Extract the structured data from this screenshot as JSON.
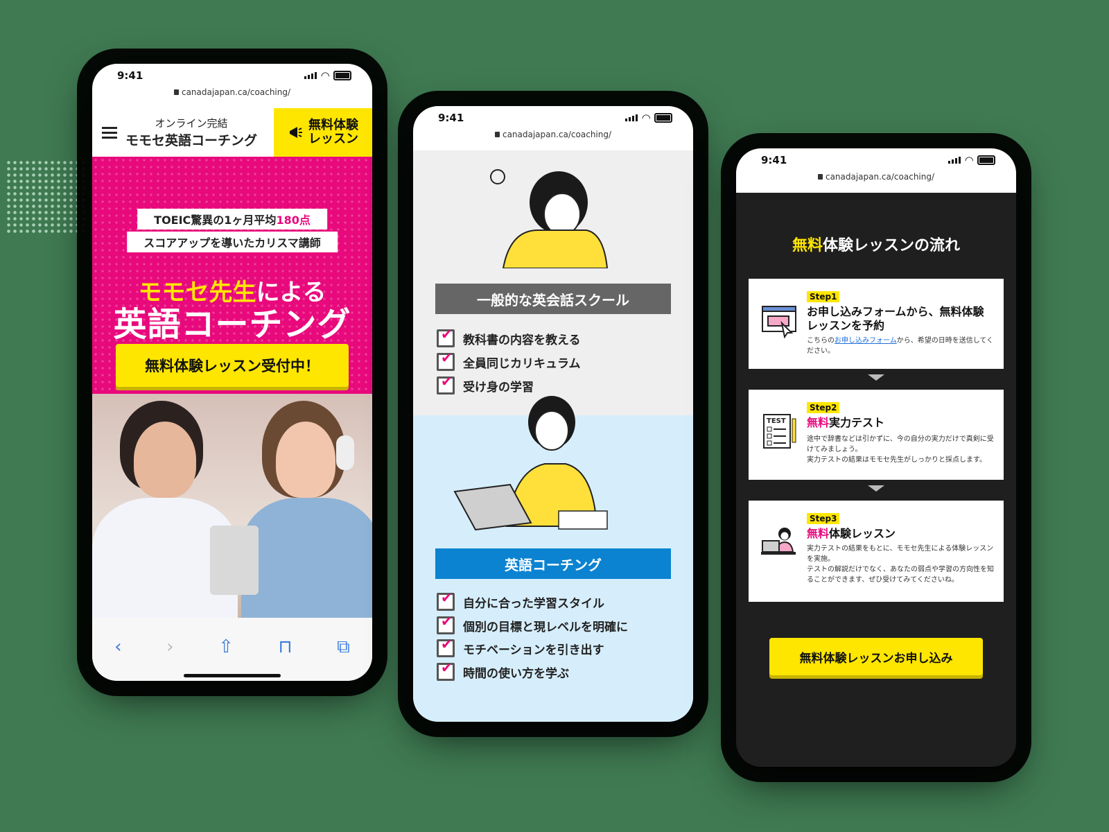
{
  "status": {
    "time": "9:41"
  },
  "url": "canadajapan.ca/coaching/",
  "phone1": {
    "brand_small": "オンライン完結",
    "brand_large": "モモセ英語コーチング",
    "header_cta": [
      "無料体験",
      "レッスン"
    ],
    "pill1_prefix": "TOEIC驚異の1ヶ月平均",
    "pill1_highlight": "180点",
    "pill2": "スコアアップを導いたカリスマ講師",
    "headline_highlight": "モモセ先生",
    "headline_rest": "による",
    "headline_main": "英語コーチング",
    "hero_button": "無料体験レッスン受付中！",
    "toolbar": [
      "back-icon",
      "forward-icon",
      "share-icon",
      "bookmarks-icon",
      "tabs-icon"
    ]
  },
  "phone2": {
    "label_general": "一般的な英会話スクール",
    "general_items": [
      "教科書の内容を教える",
      "全員同じカリキュラム",
      "受け身の学習"
    ],
    "label_coaching": "英語コーチング",
    "coaching_items": [
      "自分に合った学習スタイル",
      "個別の目標と現レベルを明確に",
      "モチベーションを引き出す",
      "時間の使い方を学ぶ"
    ]
  },
  "phone3": {
    "title_highlight": "無料",
    "title_rest": "体験レッスンの流れ",
    "steps": [
      {
        "tag": "Step1",
        "title": "お申し込みフォームから、無料体験レッスンを予約",
        "desc_pre": "こちらの",
        "desc_link": "お申し込みフォーム",
        "desc_post": "から、希望の日時を送信してください。"
      },
      {
        "tag": "Step2",
        "title_highlight": "無料",
        "title_rest": "実力テスト",
        "desc": "途中で辞書などは引かずに、今の自分の実力だけで真剣に受けてみましょう。",
        "desc2": "実力テストの結果はモモセ先生がしっかりと採点します。"
      },
      {
        "tag": "Step3",
        "title_highlight": "無料",
        "title_rest": "体験レッスン",
        "desc": "実力テストの結果をもとに、モモセ先生による体験レッスンを実施。",
        "desc2": "テストの解説だけでなく、あなたの弱点や学習の方向性を知ることができます、ぜひ受けてみてくださいね。"
      }
    ],
    "cta": "無料体験レッスンお申し込み"
  },
  "colors": {
    "pink": "#e8097c",
    "yellow": "#ffe600",
    "blue": "#0b83d1",
    "dark": "#1f1f1f"
  }
}
